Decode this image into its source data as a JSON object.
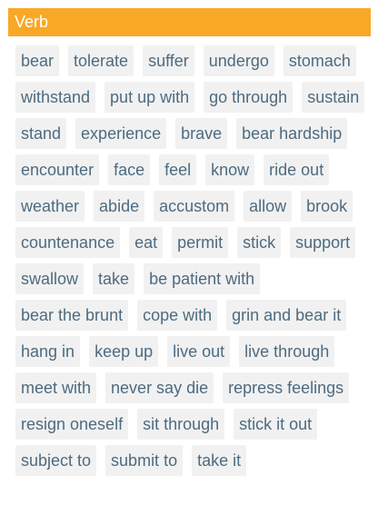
{
  "header": {
    "title": "Verb"
  },
  "colors": {
    "header_bg": "#f9a826",
    "chip_bg": "#f1f1f1",
    "chip_text": "#4d6b80"
  },
  "synonyms": [
    "bear",
    "tolerate",
    "suffer",
    "undergo",
    "stomach",
    "withstand",
    "put up with",
    "go through",
    "sustain",
    "stand",
    "experience",
    "brave",
    "bear hardship",
    "encounter",
    "face",
    "feel",
    "know",
    "ride out",
    "weather",
    "abide",
    "accustom",
    "allow",
    "brook",
    "countenance",
    "eat",
    "permit",
    "stick",
    "support",
    "swallow",
    "take",
    "be patient with",
    "bear the brunt",
    "cope with",
    "grin and bear it",
    "hang in",
    "keep up",
    "live out",
    "live through",
    "meet with",
    "never say die",
    "repress feelings",
    "resign oneself",
    "sit through",
    "stick it out",
    "subject to",
    "submit to",
    "take it"
  ]
}
